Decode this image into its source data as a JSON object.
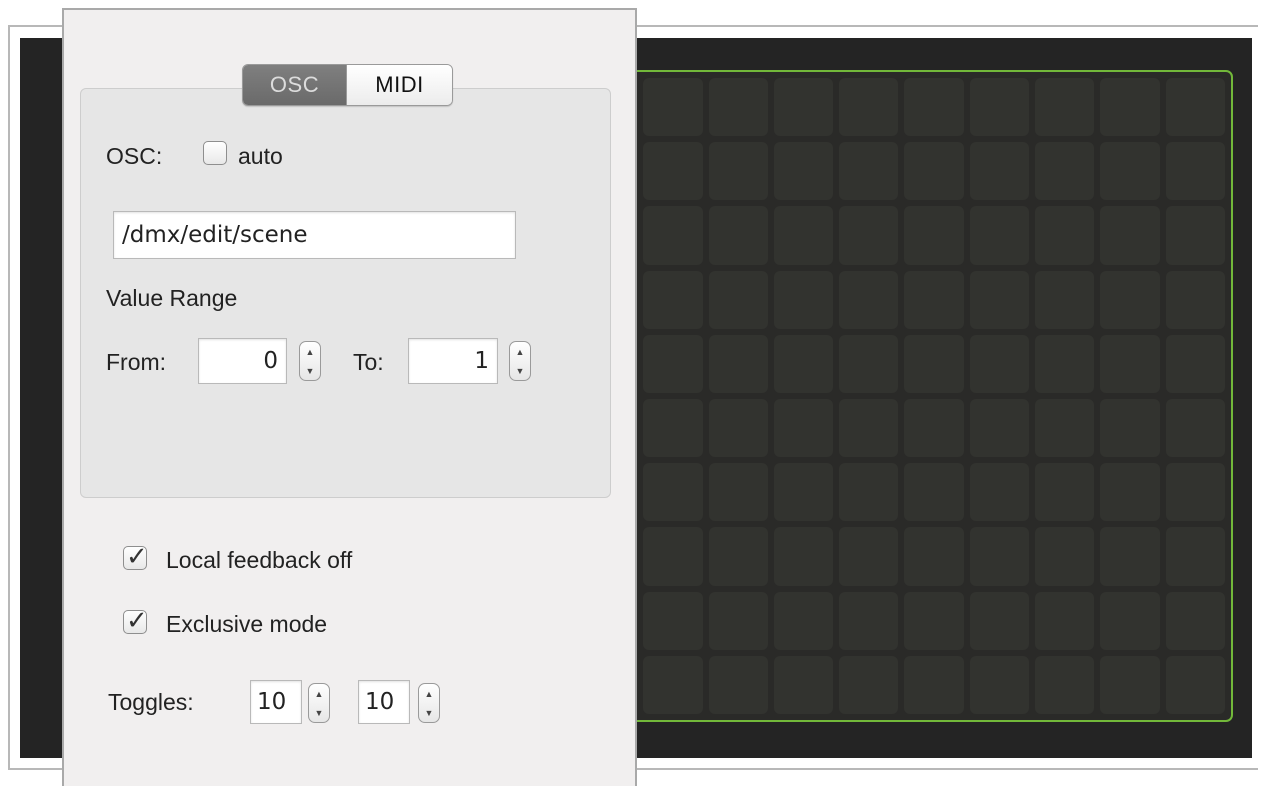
{
  "tabs": {
    "osc_label": "OSC",
    "midi_label": "MIDI",
    "active": "OSC"
  },
  "osc": {
    "label": "OSC:",
    "auto_label": "auto",
    "auto_checked": false,
    "address_value": "/dmx/edit/scene"
  },
  "value_range": {
    "heading": "Value Range",
    "from_label": "From:",
    "from_value": "0",
    "to_label": "To:",
    "to_value": "1"
  },
  "options": {
    "local_feedback_label": "Local feedback off",
    "local_feedback_checked": true,
    "exclusive_label": "Exclusive mode",
    "exclusive_checked": true
  },
  "toggles": {
    "label": "Toggles:",
    "columns_value": "10",
    "rows_value": "10"
  },
  "matrix": {
    "columns": 10,
    "rows": 10,
    "border_color": "#72b83a",
    "background_color": "#242424"
  },
  "icons": {
    "checkmark": "checkmark-icon",
    "stepper_up": "chevron-up-icon",
    "stepper_down": "chevron-down-icon"
  }
}
